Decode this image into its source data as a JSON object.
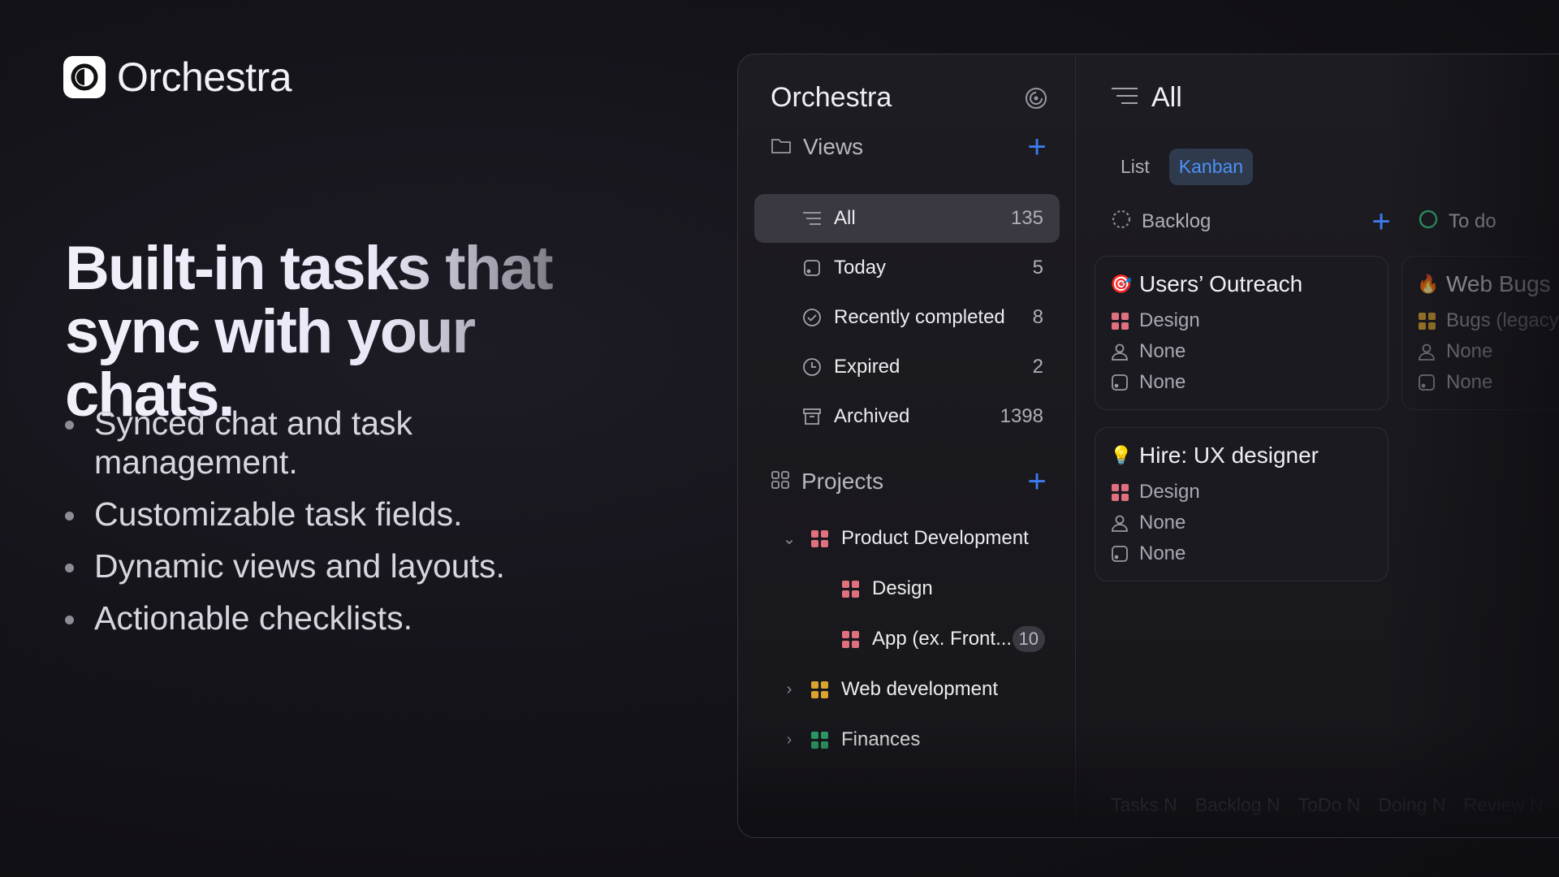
{
  "brand": {
    "name": "Orchestra"
  },
  "hero": {
    "headline_line1": "Built-in tasks that",
    "headline_line2": "sync with your chats.",
    "bullets": [
      "Synced chat and task management.",
      "Customizable task fields.",
      "Dynamic views and layouts.",
      "Actionable checklists."
    ]
  },
  "sidebar": {
    "title": "Orchestra",
    "views_label": "Views",
    "views": [
      {
        "label": "All",
        "count": "135",
        "icon": "list-icon"
      },
      {
        "label": "Today",
        "count": "5",
        "icon": "calendar-day-icon"
      },
      {
        "label": "Recently completed",
        "count": "8",
        "icon": "check-circle-icon"
      },
      {
        "label": "Expired",
        "count": "2",
        "icon": "clock-icon"
      },
      {
        "label": "Archived",
        "count": "1398",
        "icon": "archive-icon"
      }
    ],
    "projects_label": "Projects",
    "projects": [
      {
        "label": "Product Development",
        "expanded": true,
        "color": "#e0707e"
      },
      {
        "label": "Design",
        "color": "#e0707e"
      },
      {
        "label": "App (ex. Front...",
        "badge": "10",
        "color": "#e0707e"
      },
      {
        "label": "Web development",
        "expanded": false,
        "color": "#d9a32e"
      },
      {
        "label": "Finances",
        "expanded": false,
        "color": "#2fa36b"
      }
    ]
  },
  "main": {
    "title": "All",
    "tabs": [
      {
        "label": "List",
        "active": false
      },
      {
        "label": "Kanban",
        "active": true
      }
    ],
    "columns": [
      {
        "title": "Backlog",
        "cards": [
          {
            "emoji": "🎯",
            "title": "Users’ Outreach",
            "project": "Design",
            "assignee": "None",
            "due": "None"
          },
          {
            "emoji": "💡",
            "title": "Hire: UX designer",
            "project": "Design",
            "assignee": "None",
            "due": "None"
          }
        ]
      },
      {
        "title": "To do",
        "cards": [
          {
            "emoji": "🔥",
            "title": "Web Bugs",
            "project": "Bugs (legacy",
            "assignee": "None",
            "due": "None"
          }
        ]
      }
    ],
    "footer_stats": [
      "Tasks N",
      "Backlog N",
      "ToDo N",
      "Doing N",
      "Review N"
    ]
  },
  "colors": {
    "accent": "#3d7bf0",
    "tab_active_text": "#4d92f5",
    "design_red": "#e0707e",
    "web_yellow": "#d9a32e",
    "finance_green": "#2fa36b",
    "todo_green": "#2fa36b"
  }
}
